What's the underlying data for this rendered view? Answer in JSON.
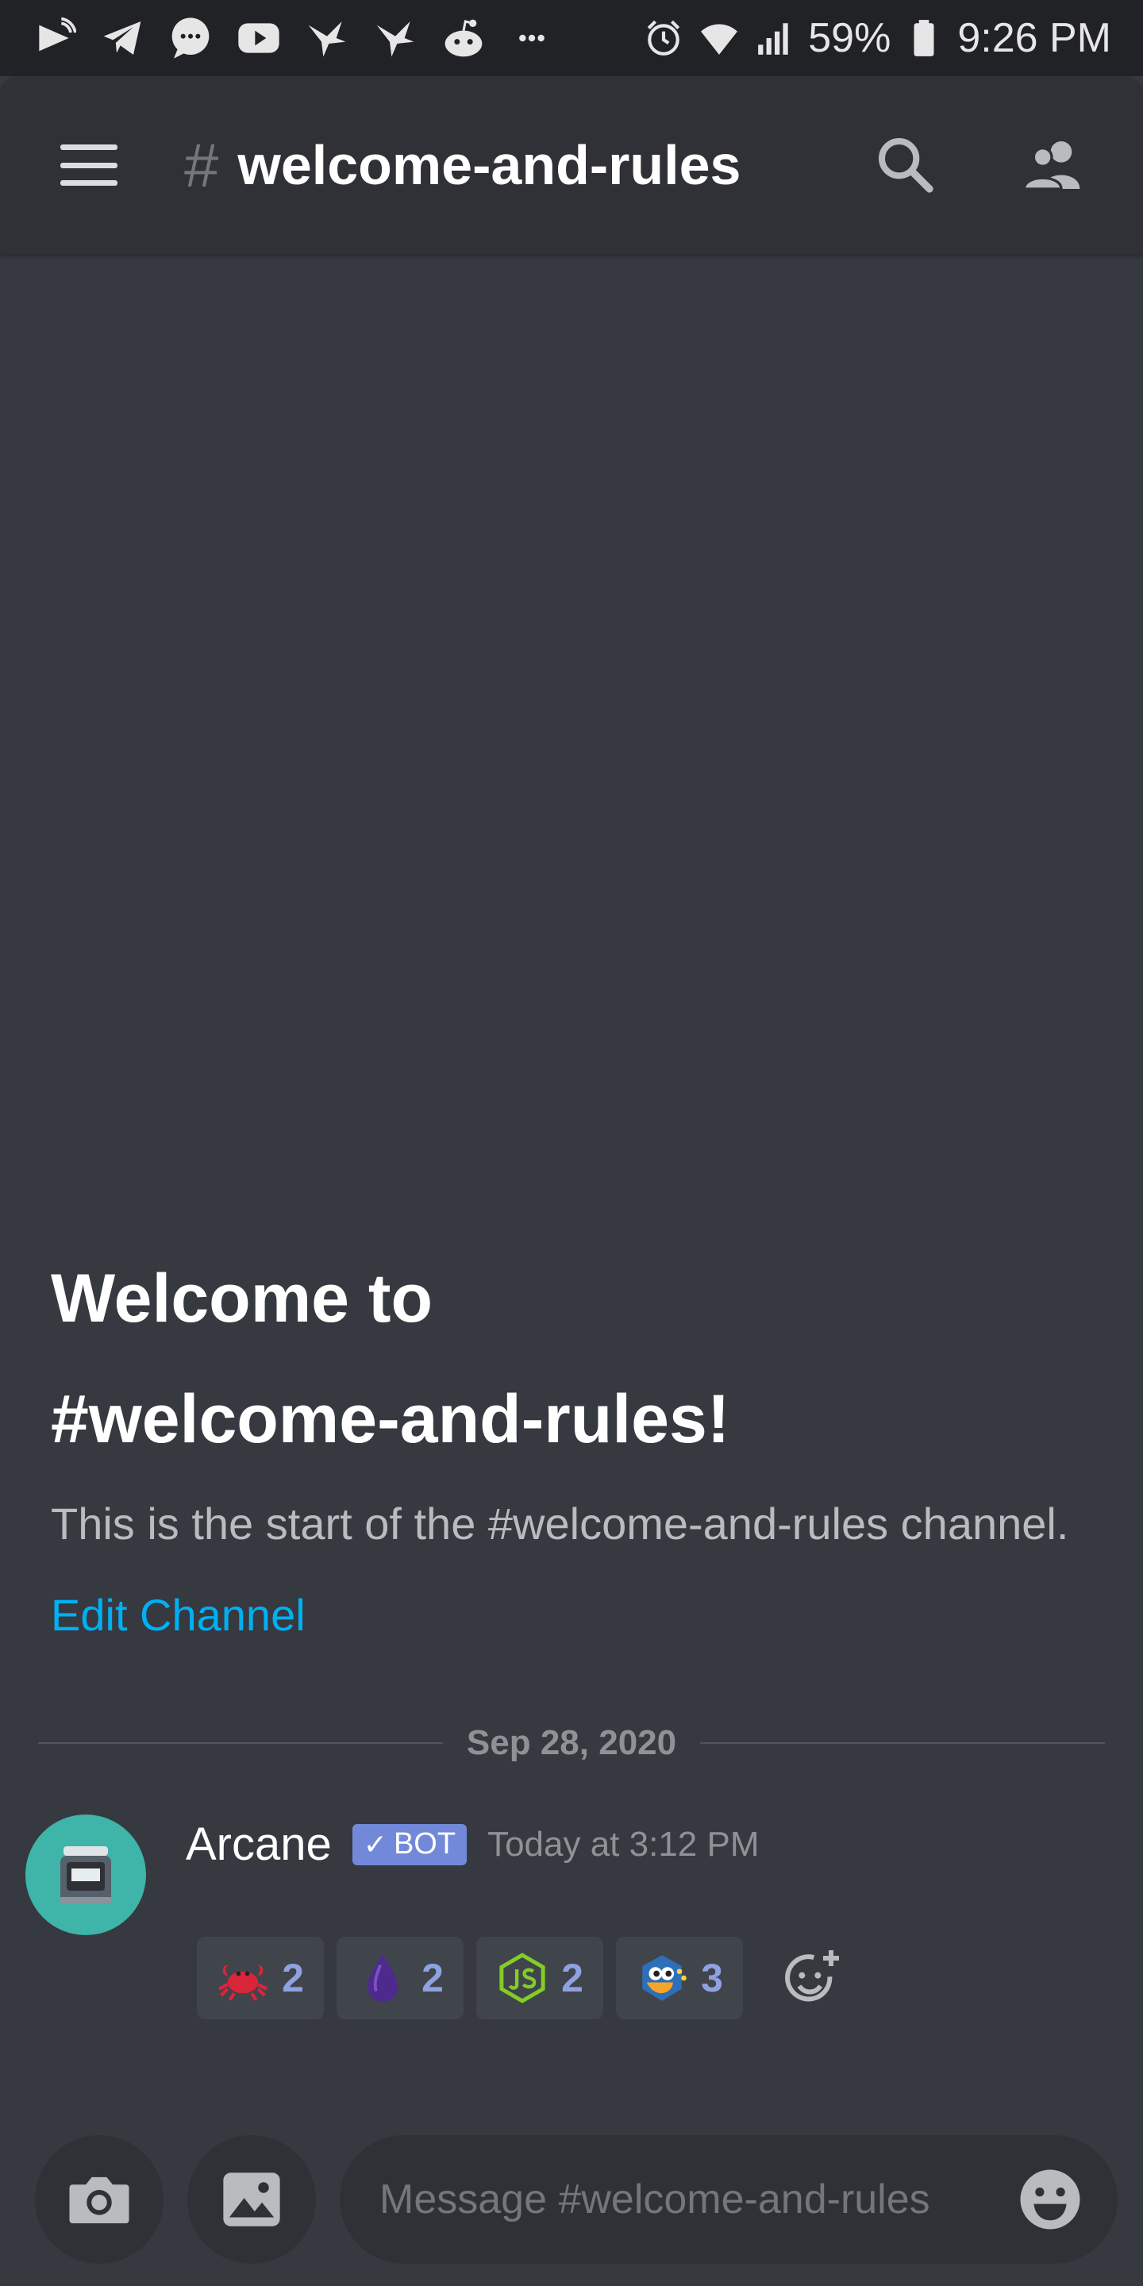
{
  "status_bar": {
    "left_icons": [
      "cast-icon",
      "telegram-icon",
      "messages-icon",
      "youtube-icon",
      "bird-app-icon",
      "bird-app-icon",
      "reddit-icon",
      "more-notifications-icon"
    ],
    "battery_percent": "59%",
    "time": "9:26 PM"
  },
  "header": {
    "hash": "#",
    "channel_name": "welcome-and-rules"
  },
  "welcome": {
    "title_line1": "Welcome to",
    "title_line2": "#welcome-and-rules!",
    "description": "This is the start of the #welcome-and-rules channel.",
    "edit_label": "Edit Channel"
  },
  "divider": {
    "date": "Sep 28, 2020"
  },
  "message": {
    "username": "Arcane",
    "bot_tag": "BOT",
    "bot_check": "✓",
    "timestamp": "Today at 3:12 PM",
    "reactions": [
      {
        "emoji": "crab-emoji",
        "count": "2"
      },
      {
        "emoji": "elixir-drop-emoji",
        "count": "2"
      },
      {
        "emoji": "nodejs-emoji",
        "count": "2"
      },
      {
        "emoji": "python-emoji",
        "count": "3"
      }
    ]
  },
  "composer": {
    "placeholder": "Message #welcome-and-rules"
  },
  "colors": {
    "background": "#36393f",
    "header": "#2f3136",
    "status_bar": "#202225",
    "link": "#00b0f4",
    "bot_tag": "#7289da",
    "reaction_count": "#8ea1e1",
    "avatar": "#3fb4a9"
  }
}
